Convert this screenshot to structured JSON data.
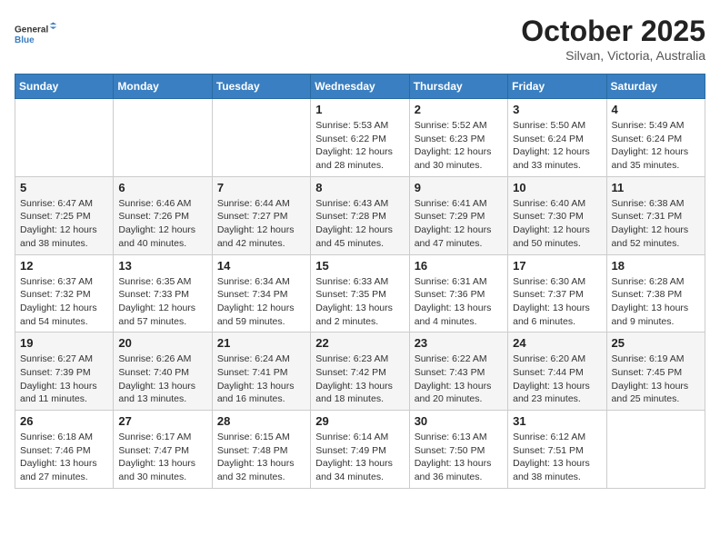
{
  "header": {
    "logo_line1": "General",
    "logo_line2": "Blue",
    "month": "October 2025",
    "location": "Silvan, Victoria, Australia"
  },
  "weekdays": [
    "Sunday",
    "Monday",
    "Tuesday",
    "Wednesday",
    "Thursday",
    "Friday",
    "Saturday"
  ],
  "weeks": [
    [
      {
        "day": "",
        "info": ""
      },
      {
        "day": "",
        "info": ""
      },
      {
        "day": "",
        "info": ""
      },
      {
        "day": "1",
        "info": "Sunrise: 5:53 AM\nSunset: 6:22 PM\nDaylight: 12 hours and 28 minutes."
      },
      {
        "day": "2",
        "info": "Sunrise: 5:52 AM\nSunset: 6:23 PM\nDaylight: 12 hours and 30 minutes."
      },
      {
        "day": "3",
        "info": "Sunrise: 5:50 AM\nSunset: 6:24 PM\nDaylight: 12 hours and 33 minutes."
      },
      {
        "day": "4",
        "info": "Sunrise: 5:49 AM\nSunset: 6:24 PM\nDaylight: 12 hours and 35 minutes."
      }
    ],
    [
      {
        "day": "5",
        "info": "Sunrise: 6:47 AM\nSunset: 7:25 PM\nDaylight: 12 hours and 38 minutes."
      },
      {
        "day": "6",
        "info": "Sunrise: 6:46 AM\nSunset: 7:26 PM\nDaylight: 12 hours and 40 minutes."
      },
      {
        "day": "7",
        "info": "Sunrise: 6:44 AM\nSunset: 7:27 PM\nDaylight: 12 hours and 42 minutes."
      },
      {
        "day": "8",
        "info": "Sunrise: 6:43 AM\nSunset: 7:28 PM\nDaylight: 12 hours and 45 minutes."
      },
      {
        "day": "9",
        "info": "Sunrise: 6:41 AM\nSunset: 7:29 PM\nDaylight: 12 hours and 47 minutes."
      },
      {
        "day": "10",
        "info": "Sunrise: 6:40 AM\nSunset: 7:30 PM\nDaylight: 12 hours and 50 minutes."
      },
      {
        "day": "11",
        "info": "Sunrise: 6:38 AM\nSunset: 7:31 PM\nDaylight: 12 hours and 52 minutes."
      }
    ],
    [
      {
        "day": "12",
        "info": "Sunrise: 6:37 AM\nSunset: 7:32 PM\nDaylight: 12 hours and 54 minutes."
      },
      {
        "day": "13",
        "info": "Sunrise: 6:35 AM\nSunset: 7:33 PM\nDaylight: 12 hours and 57 minutes."
      },
      {
        "day": "14",
        "info": "Sunrise: 6:34 AM\nSunset: 7:34 PM\nDaylight: 12 hours and 59 minutes."
      },
      {
        "day": "15",
        "info": "Sunrise: 6:33 AM\nSunset: 7:35 PM\nDaylight: 13 hours and 2 minutes."
      },
      {
        "day": "16",
        "info": "Sunrise: 6:31 AM\nSunset: 7:36 PM\nDaylight: 13 hours and 4 minutes."
      },
      {
        "day": "17",
        "info": "Sunrise: 6:30 AM\nSunset: 7:37 PM\nDaylight: 13 hours and 6 minutes."
      },
      {
        "day": "18",
        "info": "Sunrise: 6:28 AM\nSunset: 7:38 PM\nDaylight: 13 hours and 9 minutes."
      }
    ],
    [
      {
        "day": "19",
        "info": "Sunrise: 6:27 AM\nSunset: 7:39 PM\nDaylight: 13 hours and 11 minutes."
      },
      {
        "day": "20",
        "info": "Sunrise: 6:26 AM\nSunset: 7:40 PM\nDaylight: 13 hours and 13 minutes."
      },
      {
        "day": "21",
        "info": "Sunrise: 6:24 AM\nSunset: 7:41 PM\nDaylight: 13 hours and 16 minutes."
      },
      {
        "day": "22",
        "info": "Sunrise: 6:23 AM\nSunset: 7:42 PM\nDaylight: 13 hours and 18 minutes."
      },
      {
        "day": "23",
        "info": "Sunrise: 6:22 AM\nSunset: 7:43 PM\nDaylight: 13 hours and 20 minutes."
      },
      {
        "day": "24",
        "info": "Sunrise: 6:20 AM\nSunset: 7:44 PM\nDaylight: 13 hours and 23 minutes."
      },
      {
        "day": "25",
        "info": "Sunrise: 6:19 AM\nSunset: 7:45 PM\nDaylight: 13 hours and 25 minutes."
      }
    ],
    [
      {
        "day": "26",
        "info": "Sunrise: 6:18 AM\nSunset: 7:46 PM\nDaylight: 13 hours and 27 minutes."
      },
      {
        "day": "27",
        "info": "Sunrise: 6:17 AM\nSunset: 7:47 PM\nDaylight: 13 hours and 30 minutes."
      },
      {
        "day": "28",
        "info": "Sunrise: 6:15 AM\nSunset: 7:48 PM\nDaylight: 13 hours and 32 minutes."
      },
      {
        "day": "29",
        "info": "Sunrise: 6:14 AM\nSunset: 7:49 PM\nDaylight: 13 hours and 34 minutes."
      },
      {
        "day": "30",
        "info": "Sunrise: 6:13 AM\nSunset: 7:50 PM\nDaylight: 13 hours and 36 minutes."
      },
      {
        "day": "31",
        "info": "Sunrise: 6:12 AM\nSunset: 7:51 PM\nDaylight: 13 hours and 38 minutes."
      },
      {
        "day": "",
        "info": ""
      }
    ]
  ]
}
